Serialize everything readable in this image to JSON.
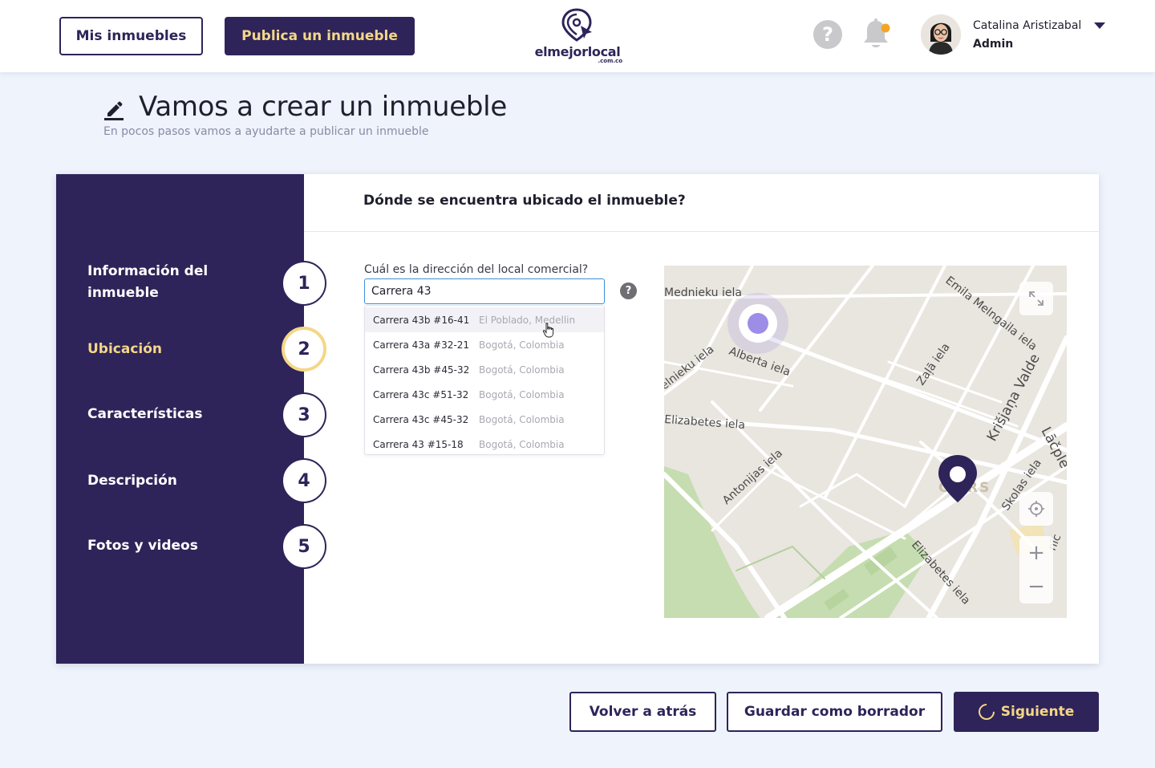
{
  "header": {
    "my_properties_label": "Mis inmuebles",
    "publish_label": "Publica un inmueble",
    "logo_text": "elmejorlocal",
    "logo_sub": ".com.co",
    "help_symbol": "?",
    "notification_icon": "bell-icon",
    "user": {
      "name": "Catalina Aristizabal",
      "role": "Admin"
    }
  },
  "page": {
    "title": "Vamos a crear un inmueble",
    "subtitle": "En pocos pasos vamos a ayudarte a publicar un inmueble"
  },
  "steps": [
    {
      "label": "Información del inmueble",
      "number": "1",
      "active": false
    },
    {
      "label": "Ubicación",
      "number": "2",
      "active": true
    },
    {
      "label": "Características",
      "number": "3",
      "active": false
    },
    {
      "label": "Descripción",
      "number": "4",
      "active": false
    },
    {
      "label": "Fotos y videos",
      "number": "5",
      "active": false
    }
  ],
  "location": {
    "section_title": "Dónde se encuentra ubicado el inmueble?",
    "address_label": "Cuál es la dirección del local comercial?",
    "address_value": "Carrera 43",
    "help_symbol": "?",
    "suggestions": [
      {
        "street": "Carrera 43b #16-41",
        "city": "El Poblado, Medellin"
      },
      {
        "street": "Carrera 43a #32-21",
        "city": "Bogotá, Colombia"
      },
      {
        "street": "Carrera 43b #45-32",
        "city": "Bogotá, Colombia"
      },
      {
        "street": "Carrera 43c #51-32",
        "city": "Bogotá, Colombia"
      },
      {
        "street": "Carrera 43c #45-32",
        "city": "Bogotá, Colombia"
      },
      {
        "street": "Carrera 43 #15-18",
        "city": "Bogotá, Colombia"
      }
    ]
  },
  "map": {
    "streets": [
      "Mednieku iela",
      "Emila Melngaila iela",
      "Alberta iela",
      "ēlnieku iela",
      "Zaļā iela",
      "Elizabetes iela",
      "Krišjaņa Valde",
      "Lāčple",
      "Antonijas iela",
      "CE RS",
      "Skolas iela",
      "Elizabetes iela",
      "nīc"
    ],
    "zoom_in": "+",
    "zoom_out": "−"
  },
  "footer": {
    "back_label": "Volver a atrás",
    "draft_label": "Guardar como borrador",
    "next_label": "Siguiente"
  },
  "colors": {
    "brand": "#2e2459",
    "accent": "#f4d787"
  }
}
